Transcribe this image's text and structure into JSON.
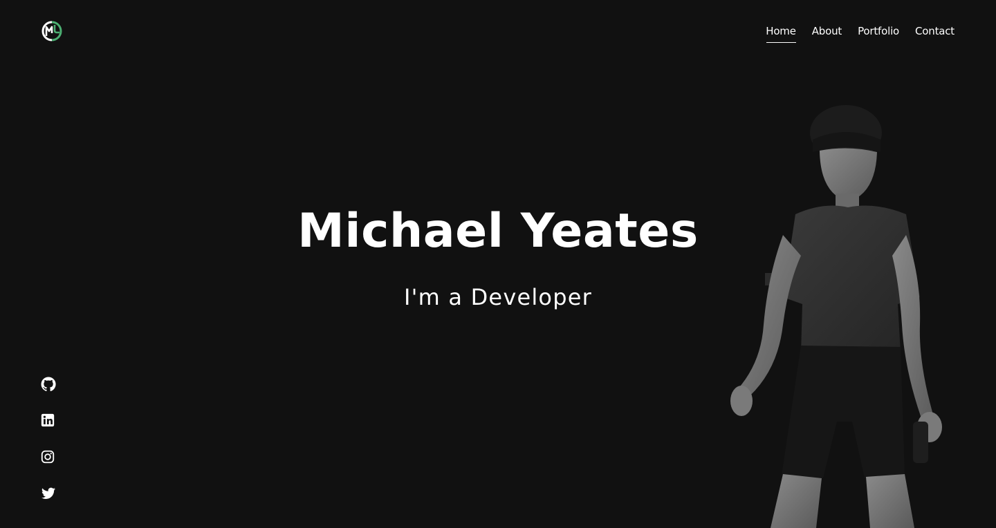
{
  "logo": {
    "initials": "MY",
    "accent_color": "#4caf72"
  },
  "nav": {
    "items": [
      {
        "label": "Home",
        "active": true
      },
      {
        "label": "About",
        "active": false
      },
      {
        "label": "Portfolio",
        "active": false
      },
      {
        "label": "Contact",
        "active": false
      }
    ]
  },
  "hero": {
    "name": "Michael Yeates",
    "tagline": "I'm a Developer"
  },
  "socials": [
    {
      "icon": "github-icon"
    },
    {
      "icon": "linkedin-icon"
    },
    {
      "icon": "instagram-icon"
    },
    {
      "icon": "twitter-icon"
    }
  ],
  "colors": {
    "background": "#111111",
    "text": "#ffffff",
    "accent": "#4caf72"
  }
}
